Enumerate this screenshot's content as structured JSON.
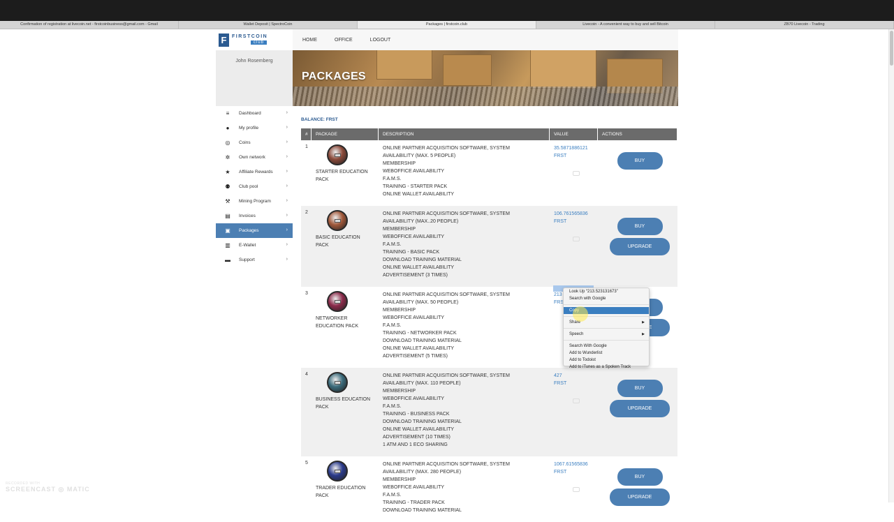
{
  "browser_tabs": [
    "Confirmation of registration at livecoin.net - firstcoinbusiness@gmail.com - Gmail",
    "Wallet Deposit | SpectroCoin",
    "Packages | firstcoin.club",
    "Livecoin - A convenient way to buy and sell Bitcoin",
    "ZB70 Livecoin - Trading"
  ],
  "active_tab_index": 2,
  "logo": {
    "mark": "F",
    "text": "FIRSTCOIN",
    "club": "club"
  },
  "user": {
    "name": "John Rosemberg"
  },
  "sidebar": {
    "items": [
      {
        "label": "Dashboard",
        "icon": "dashboard-icon"
      },
      {
        "label": "My profile",
        "icon": "user-icon"
      },
      {
        "label": "Coins",
        "icon": "coins-icon"
      },
      {
        "label": "Own network",
        "icon": "network-icon"
      },
      {
        "label": "Affiliate Rewards",
        "icon": "star-icon"
      },
      {
        "label": "Club pool",
        "icon": "users-icon"
      },
      {
        "label": "Mining Program",
        "icon": "pickaxe-icon"
      },
      {
        "label": "Invoices",
        "icon": "invoice-icon"
      },
      {
        "label": "Packages",
        "icon": "package-icon",
        "active": true
      },
      {
        "label": "E-Wallet",
        "icon": "wallet-icon"
      },
      {
        "label": "Support",
        "icon": "chat-icon"
      }
    ]
  },
  "nav": {
    "home": "HOME",
    "office": "OFFICE",
    "logout": "LOGOUT"
  },
  "banner": {
    "title": "PACKAGES"
  },
  "balance": "BALANCE: FRST",
  "table": {
    "headers": [
      "#",
      "PACKAGE",
      "DESCRIPTION",
      "VALUE",
      "ACTIONS"
    ],
    "rows": [
      {
        "num": "1",
        "name": "STARTER EDUCATION PACK",
        "medal_color": "#8a4a3a",
        "desc": [
          "ONLINE PARTNER ACQUISITION SOFTWARE, SYSTEM",
          "AVAILABILITY (MAX. 5 PEOPLE)",
          "MEMBERSHIP",
          "WEBOFFICE AVAILABILITY",
          "F.A.M.S.",
          "TRAINING - STARTER PACK",
          "ONLINE WALLET AVAILABILITY"
        ],
        "value": "35.5871886121",
        "unit": "FRST",
        "buy": "BUY",
        "upgrade": null
      },
      {
        "num": "2",
        "name": "BASIC EDUCATION PACK",
        "medal_color": "#a0583a",
        "desc": [
          "ONLINE PARTNER ACQUISITION SOFTWARE, SYSTEM",
          "AVAILABILITY (MAX..20 PEOPLE)",
          "MEMBERSHIP",
          "WEBOFFICE AVAILABILITY",
          "F.A.M.S.",
          "TRAINING - BASIC PACK",
          "DOWNLOAD TRAINING MATERIAL",
          "ONLINE WALLET AVAILABILITY",
          "ADVERTISEMENT (3 TIMES)"
        ],
        "value": "106.761565836",
        "unit": "FRST",
        "buy": "BUY",
        "upgrade": "UPGRADE"
      },
      {
        "num": "3",
        "name": "NETWORKER EDUCATION PACK",
        "medal_color": "#8a2a4a",
        "desc": [
          "ONLINE PARTNER ACQUISITION SOFTWARE, SYSTEM",
          "AVAILABILITY (MAX. 50 PEOPLE)",
          "MEMBERSHIP",
          "WEBOFFICE AVAILABILITY",
          "F.A.M.S.",
          "TRAINING - NETWORKER PACK",
          "DOWNLOAD TRAINING MATERIAL",
          "ONLINE WALLET AVAILABILITY",
          "ADVERTISEMENT (5 TIMES)"
        ],
        "value": "213",
        "unit": "FRST",
        "buy": "BUY",
        "upgrade": "UPGRADE"
      },
      {
        "num": "4",
        "name": "BUSINESS EDUCATION PACK",
        "medal_color": "#3a6a7a",
        "desc": [
          "ONLINE PARTNER ACQUISITION SOFTWARE, SYSTEM",
          "AVAILABILITY (MAX. 110 PEOPLE)",
          "MEMBERSHIP",
          "WEBOFFICE AVAILABILITY",
          "F.A.M.S.",
          "TRAINING - BUSINESS PACK",
          "DOWNLOAD TRAINING MATERIAL",
          "ONLINE WALLET AVAILABILITY",
          "ADVERTISEMENT (10 TIMES)",
          "1 ATM AND 1 ECO SHARING"
        ],
        "value": "427",
        "unit": "FRST",
        "buy": "BUY",
        "upgrade": "UPGRADE"
      },
      {
        "num": "5",
        "name": "TRADER EDUCATION PACK",
        "medal_color": "#2a3a8a",
        "desc": [
          "ONLINE PARTNER ACQUISITION SOFTWARE, SYSTEM",
          "AVAILABILITY (MAX. 280 PEOPLE)",
          "MEMBERSHIP",
          "WEBOFFICE AVAILABILITY",
          "F.A.M.S.",
          "TRAINING - TRADER PACK",
          "DOWNLOAD TRAINING MATERIAL"
        ],
        "value": "1067.61565836",
        "unit": "FRST",
        "buy": "BUY",
        "upgrade": "UPGRADE"
      }
    ]
  },
  "context_menu": {
    "items": [
      {
        "label": "Look Up “213.523131673”"
      },
      {
        "label": "Search with Google"
      },
      {
        "sep": true
      },
      {
        "label": "Copy",
        "selected": true
      },
      {
        "sep": true
      },
      {
        "label": "Share",
        "submenu": true
      },
      {
        "sep": true
      },
      {
        "label": "Speech",
        "submenu": true
      },
      {
        "sep": true
      },
      {
        "label": "Search With Google"
      },
      {
        "label": "Add to Wunderlist"
      },
      {
        "label": "Add to Todoist"
      },
      {
        "label": "Add to iTunes as a Spoken Track"
      }
    ]
  },
  "watermark": {
    "small": "RECORDED WITH",
    "big": "SCREENCAST ◎ MATIC"
  }
}
